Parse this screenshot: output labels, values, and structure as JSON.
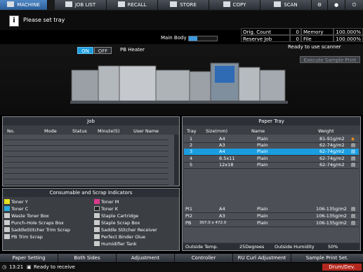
{
  "tabs": [
    {
      "label": "MACHINE",
      "active": true
    },
    {
      "label": "JOB LIST",
      "active": false
    },
    {
      "label": "RECALL",
      "active": false
    },
    {
      "label": "STORE",
      "active": false
    },
    {
      "label": "COPY",
      "active": false
    },
    {
      "label": "SCAN",
      "active": false
    }
  ],
  "message": "Please set tray",
  "main_body_label": "Main Body",
  "counters": {
    "orig_count_label": "Orig. Count",
    "orig_count_value": "0",
    "memory_label": "Memory",
    "memory_value": "100.000%",
    "reserve_job_label": "Reserve Job",
    "reserve_job_value": "0",
    "file_amount_label": "File Amount",
    "file_amount_value": "100.000%"
  },
  "scanner_status": "Ready to use scanner",
  "pb_heater": {
    "on_label": "ON",
    "off_label": "OFF",
    "label": "PB Heater"
  },
  "execute_sample_print": "Execute Sample Print",
  "job_panel": {
    "title": "Job",
    "columns": [
      "No.",
      "Mode",
      "Status",
      "Minute(S)",
      "User Name"
    ]
  },
  "consumables": {
    "title": "Consumable and Scrap Indicators",
    "left": [
      "Toner Y",
      "Toner C",
      "Waste Toner Box",
      "Punch-Hole Scraps Box",
      "SaddleStitcher Trim Scrap",
      "PB Trim Scrap"
    ],
    "right": [
      "Toner M",
      "Toner K",
      "Staple Cartridge",
      "Staple Scrap Box",
      "Saddle Stitcher Receiver",
      "Perfect Binder Glue",
      "Humidifier Tank"
    ]
  },
  "paper_tray": {
    "title": "Paper Tray",
    "columns": [
      "Tray",
      "Size(mm)",
      "Name",
      "Weight"
    ],
    "rows": [
      {
        "tray": "1",
        "size": "A4",
        "name": "Plain",
        "weight": "81-91g/m2",
        "selected": false
      },
      {
        "tray": "2",
        "size": "A3",
        "name": "Plain",
        "weight": "62-74g/m2",
        "selected": false
      },
      {
        "tray": "3",
        "size": "A4",
        "name": "Plain",
        "weight": "62-74g/m2",
        "selected": true
      },
      {
        "tray": "4",
        "size": "8.5x11",
        "name": "Plain",
        "weight": "62-74g/m2",
        "selected": false
      },
      {
        "tray": "5",
        "size": "12x18",
        "name": "Plain",
        "weight": "62-74g/m2",
        "selected": false
      }
    ],
    "rows2": [
      {
        "tray": "PI1",
        "size": "A4",
        "name": "Plain",
        "weight": "106-135g/m2"
      },
      {
        "tray": "PI2",
        "size": "A3",
        "name": "Plain",
        "weight": "106-135g/m2"
      },
      {
        "tray": "PB",
        "size": "307.0 x 472.0",
        "name": "Plain",
        "weight": "106-135g/m2"
      }
    ],
    "outside_temp_label": "Outside Temp.",
    "outside_temp_value": "25Degrees",
    "outside_humidity_label": "Outside Humidity",
    "outside_humidity_value": "50%"
  },
  "bottom_tabs": [
    "Paper Setting",
    "Both Sides",
    "Adjustment",
    "Controller",
    "RU Curl Adjustment",
    "Sample Print Set."
  ],
  "status": {
    "time": "13:21",
    "text": "Ready to receive",
    "drum_label": "Drum/Dev."
  }
}
